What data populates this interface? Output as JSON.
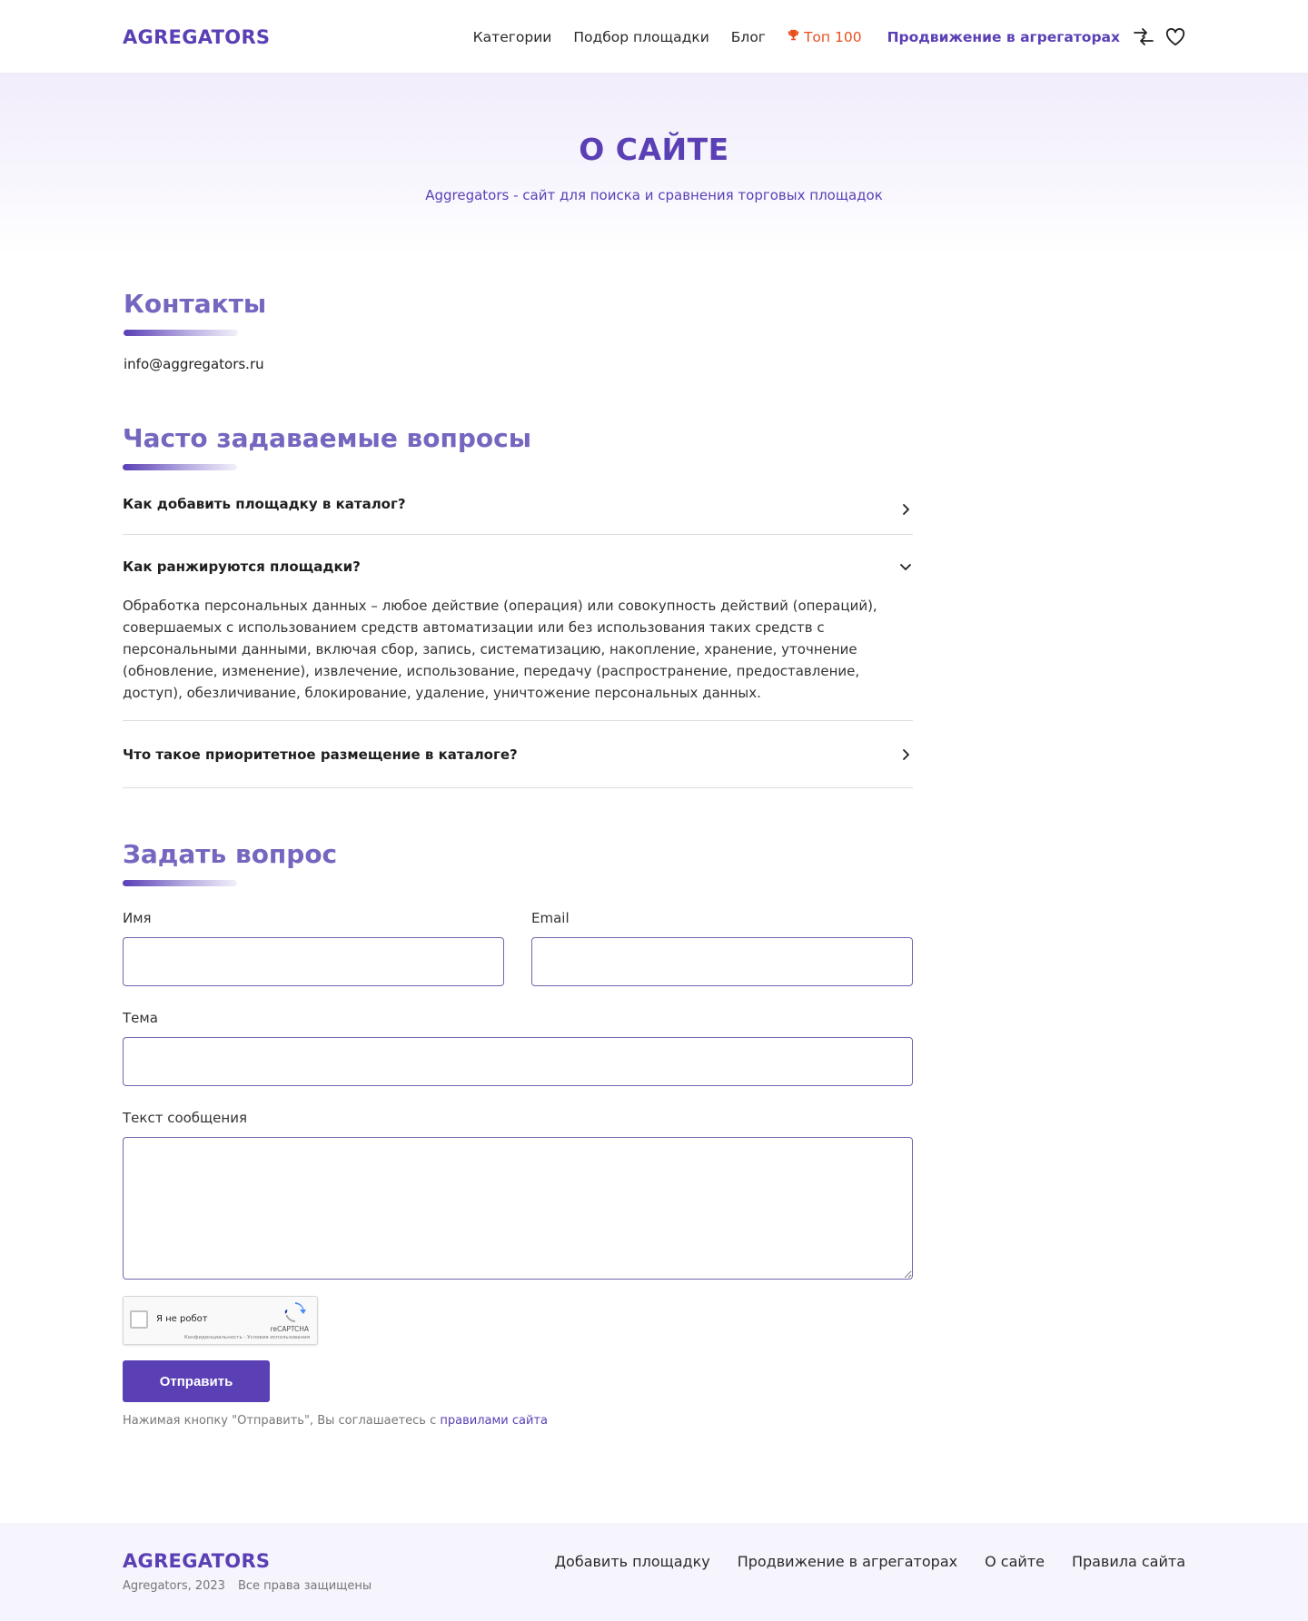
{
  "header": {
    "logo": "AGREGATORS",
    "nav": {
      "categories": "Категории",
      "selection": "Подбор площадки",
      "blog": "Блог",
      "top100": "Топ 100",
      "promo": "Продвижение в агрегаторах"
    },
    "icons": [
      "compare-icon",
      "heart-icon",
      "trophy-icon"
    ]
  },
  "hero": {
    "title": "О САЙТЕ",
    "subtitle": "Aggregators - сайт для поиска и сравнения торговых площадок"
  },
  "contacts": {
    "title": "Контакты",
    "email": "info@aggregators.ru"
  },
  "faq": {
    "title": "Часто задаваемые вопросы",
    "items": [
      {
        "question": "Как добавить площадку в каталог?",
        "open": false
      },
      {
        "question": "Как ранжируются площадки?",
        "open": true,
        "answer": "Обработка персональных данных – любое действие (операция) или совокупность действий (операций), совершаемых с использованием средств автоматизации или без использования таких средств с персональными данными, включая сбор, запись, систематизацию, накопление, хранение, уточнение (обновление, изменение), извлечение, использование, передачу (распространение, предоставление, доступ), обезличивание, блокирование, удаление, уничтожение персональных данных."
      },
      {
        "question": "Что такое приоритетное размещение в каталоге?",
        "open": false
      }
    ]
  },
  "ask": {
    "title": "Задать вопрос",
    "name_label": "Имя",
    "name_value": "",
    "email_label": "Email",
    "email_value": "",
    "subject_label": "Тема",
    "subject_value": "",
    "message_label": "Текст сообщения",
    "message_value": "",
    "captcha": {
      "label": "Я не робот",
      "brand": "reCAPTCHA",
      "terms": "Конфиденциальность - Условия использования"
    },
    "submit_label": "Отправить",
    "agree_text": "Нажимая кнопку \"Отправить\", Вы соглашаетесь с ",
    "agree_link": "правилами сайта"
  },
  "footer": {
    "logo": "AGREGATORS",
    "copyright": "Agregators, 2023",
    "rights": "Все права защищены",
    "links": {
      "add": "Добавить площадку",
      "promo": "Продвижение в агрегаторах",
      "about": "О сайте",
      "rules": "Правила сайта"
    }
  },
  "colors": {
    "brand": "#5a3fb5",
    "accent_orange": "#e8501e",
    "section_title": "#7666bf"
  }
}
